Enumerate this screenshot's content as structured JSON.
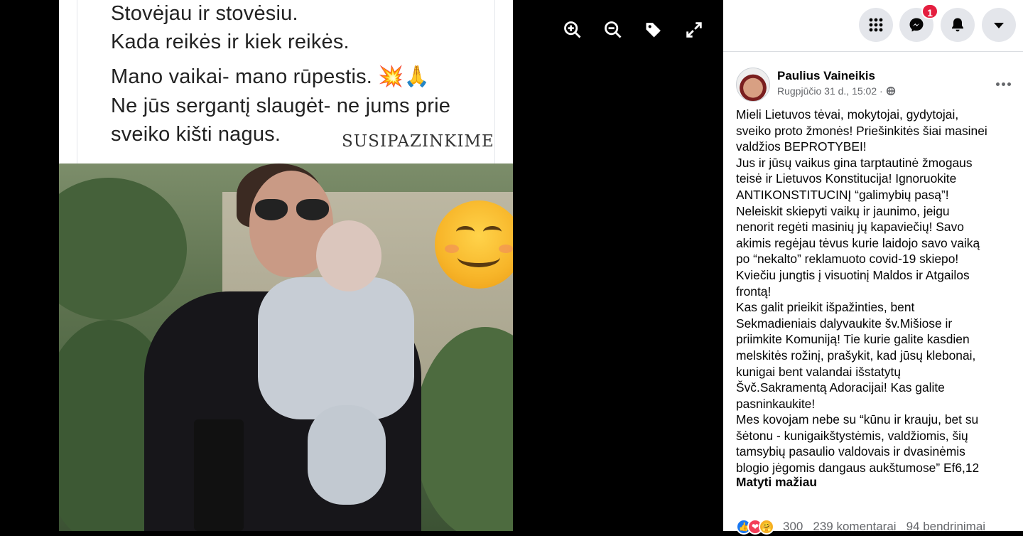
{
  "meme": {
    "lines": [
      "Stovėjau ir stovėsiu.",
      "Kada reikės ir kiek reikės.",
      "Mano vaikai- mano rūpestis. 💥🙏",
      "Ne jūs sergantį slaugėt- ne jums prie",
      "sveiko kišti nagus."
    ],
    "watermark": "SUSIPAZINKIME"
  },
  "viewer_tools": [
    "zoom-in-icon",
    "zoom-out-icon",
    "tag-icon",
    "fullscreen-icon"
  ],
  "topbar": {
    "icons": [
      "menu-grid-icon",
      "messenger-icon",
      "notifications-icon",
      "account-dropdown-icon"
    ],
    "messenger_badge": "1"
  },
  "post": {
    "author": "Paulius Vaineikis",
    "timestamp": "Rugpjūčio 31 d., 15:02 ·",
    "body_lines": [
      "Mieli Lietuvos tėvai, mokytojai, gydytojai,",
      "sveiko proto žmonės! Priešinkitės šiai masinei",
      "valdžios BEPROTYBEI!",
      "Jus ir jūsų vaikus gina tarptautinė žmogaus",
      "teisė ir Lietuvos Konstitucija! Ignoruokite",
      "ANTIKONSTITUCINĮ “galimybių pasą”!",
      "Neleiskit skiepyti vaikų ir jaunimo, jeigu",
      "nenorit regėti masinių jų kapaviečių! Savo",
      "akimis regėjau tėvus kurie laidojo savo vaiką",
      "po “nekalto” reklamuoto covid-19 skiepo!",
      "Kviečiu jungtis į visuotinį Maldos ir Atgailos",
      "frontą!",
      "Kas galit prieikit išpažinties, bent",
      "Sekmadieniais dalyvaukite šv.Mišiose ir",
      "priimkite Komuniją! Tie kurie galite kasdien",
      "melskitės rožinį, prašykit, kad jūsų klebonai,",
      "kunigai bent valandai išstatytų",
      "Švč.Sakramentą Adoracijai! Kas galite",
      "pasninkaukite!",
      "Mes kovojam nebe su “kūnu ir krauju, bet su",
      "šėtonu - kunigaikštystėmis, valdžiomis, šių",
      "tamsybių pasaulio valdovais ir dvasinėmis",
      "blogio jėgomis dangaus aukštumose” Ef6,12"
    ],
    "see_less": "Matyti mažiau",
    "reactions_count": "300",
    "comments": "239 komentarai",
    "shares": "94 bendrinimai"
  }
}
